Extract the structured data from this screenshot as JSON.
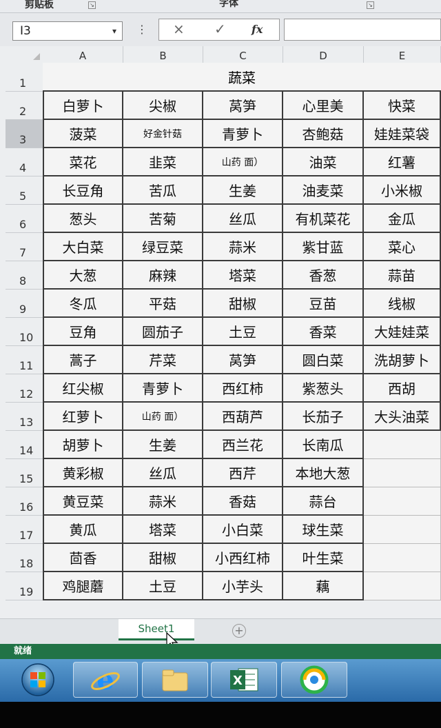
{
  "ribbon": {
    "clipboard_label": "剪贴板",
    "font_label": "字体"
  },
  "formula_bar": {
    "name_box": "I3",
    "name_dropdown": "▾",
    "cancel": "×",
    "enter": "✓",
    "fx": "fx",
    "content": ""
  },
  "columns": [
    "A",
    "B",
    "C",
    "D",
    "E"
  ],
  "rows": [
    "1",
    "2",
    "3",
    "4",
    "5",
    "6",
    "7",
    "8",
    "9",
    "10",
    "11",
    "12",
    "13",
    "14",
    "15",
    "16",
    "17",
    "18",
    "19"
  ],
  "title": "蔬菜",
  "table": [
    [
      "白萝卜",
      "尖椒",
      "莴笋",
      "心里美",
      "快菜"
    ],
    [
      "菠菜",
      "好金针菇",
      "青萝卜",
      "杏鲍菇",
      "娃娃菜袋"
    ],
    [
      "菜花",
      "韭菜",
      "山药 面）",
      "油菜",
      "红薯"
    ],
    [
      "长豆角",
      "苦瓜",
      "生姜",
      "油麦菜",
      "小米椒"
    ],
    [
      "葱头",
      "苦菊",
      "丝瓜",
      "有机菜花",
      "金瓜"
    ],
    [
      "大白菜",
      "绿豆菜",
      "蒜米",
      "紫甘蓝",
      "菜心"
    ],
    [
      "大葱",
      "麻辣",
      "塔菜",
      "香葱",
      "蒜苗"
    ],
    [
      "冬瓜",
      "平菇",
      "甜椒",
      "豆苗",
      "线椒"
    ],
    [
      "豆角",
      "圆茄子",
      "土豆",
      "香菜",
      "大娃娃菜"
    ],
    [
      "蒿子",
      "芹菜",
      "莴笋",
      "圆白菜",
      "洗胡萝卜"
    ],
    [
      "红尖椒",
      "青萝卜",
      "西红柿",
      "紫葱头",
      "西胡"
    ],
    [
      "红萝卜",
      "山药 面）",
      "西葫芦",
      "长茄子",
      "大头油菜"
    ],
    [
      "胡萝卜",
      "生姜",
      "西兰花",
      "长南瓜",
      ""
    ],
    [
      "黄彩椒",
      "丝瓜",
      "西芹",
      "本地大葱",
      ""
    ],
    [
      "黄豆菜",
      "蒜米",
      "香菇",
      "蒜台",
      ""
    ],
    [
      "黄瓜",
      "塔菜",
      "小白菜",
      "球生菜",
      ""
    ],
    [
      "茴香",
      "甜椒",
      "小西红柿",
      "叶生菜",
      ""
    ],
    [
      "鸡腿蘑",
      "土豆",
      "小芋头",
      "藕",
      ""
    ]
  ],
  "sheet_tab": "Sheet1",
  "add_sheet": "+",
  "status": "就绪",
  "taskbar": [
    "start-orb",
    "internet-explorer-icon",
    "file-explorer-icon",
    "excel-icon",
    "360-browser-icon"
  ]
}
